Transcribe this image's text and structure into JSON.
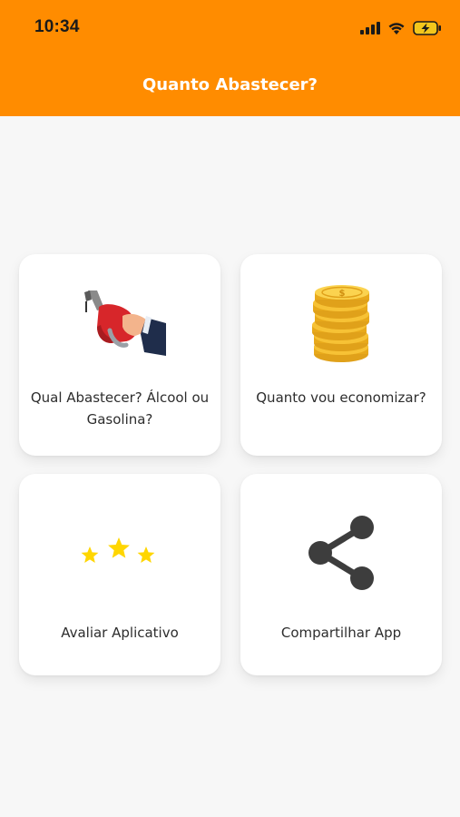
{
  "status_bar": {
    "time": "10:34"
  },
  "app_bar": {
    "title": "Quanto Abastecer?",
    "background_color": "#ff8c00"
  },
  "menu": {
    "items": [
      {
        "label": "Qual Abastecer? Álcool ou Gasolina?",
        "icon": "fuel-nozzle-icon"
      },
      {
        "label": "Quanto vou economizar?",
        "icon": "coin-stack-icon"
      },
      {
        "label": "Avaliar Aplicativo",
        "icon": "stars-icon"
      },
      {
        "label": "Compartilhar App",
        "icon": "share-icon"
      }
    ]
  }
}
